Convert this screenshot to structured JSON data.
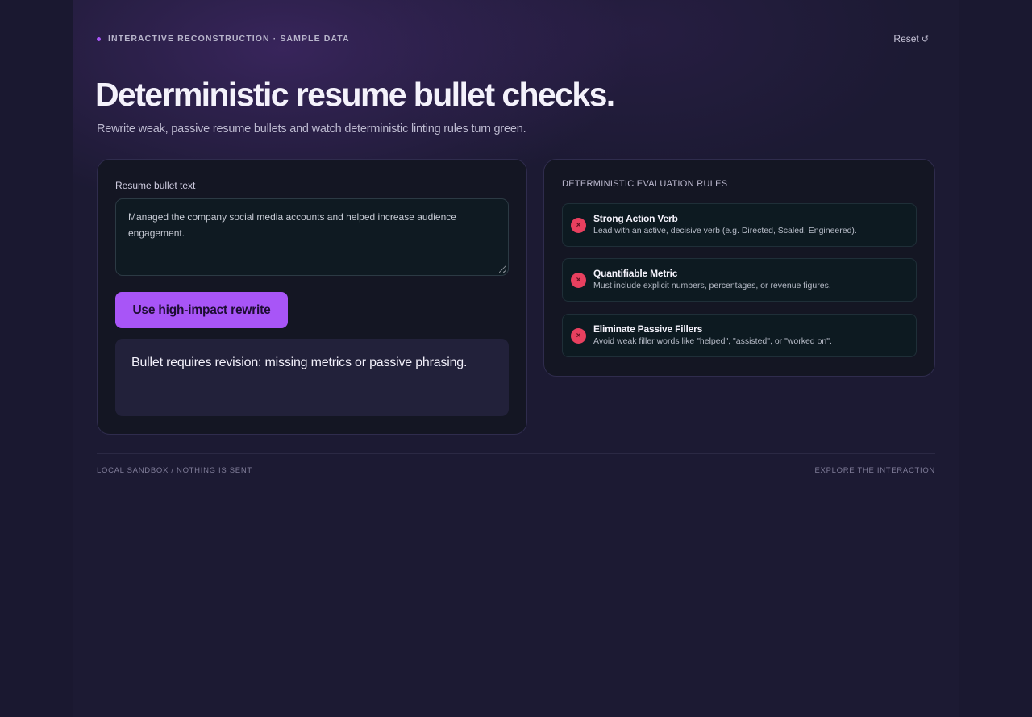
{
  "header": {
    "eyebrow": "INTERACTIVE RECONSTRUCTION · SAMPLE DATA",
    "reset_label": "Reset",
    "reset_icon": "↺"
  },
  "hero": {
    "title": "Deterministic resume bullet checks.",
    "subtitle": "Rewrite weak, passive resume bullets and watch deterministic linting rules turn green."
  },
  "editor": {
    "label": "Resume bullet text",
    "value": "Managed the company social media accounts and helped increase audience engagement.",
    "rewrite_button": "Use high-impact rewrite",
    "status": "Bullet requires revision: missing metrics or passive phrasing."
  },
  "rules": {
    "heading": "DETERMINISTIC EVALUATION RULES",
    "status_icon": "x-circle-icon",
    "fail_color": "#e8405f",
    "items": [
      {
        "title": "Strong Action Verb",
        "description": "Lead with an active, decisive verb (e.g. Directed, Scaled, Engineered).",
        "status": "fail",
        "glyph": "×"
      },
      {
        "title": "Quantifiable Metric",
        "description": "Must include explicit numbers, percentages, or revenue figures.",
        "status": "fail",
        "glyph": "×"
      },
      {
        "title": "Eliminate Passive Fillers",
        "description": "Avoid weak filler words like \"helped\", \"assisted\", or \"worked on\".",
        "status": "fail",
        "glyph": "×"
      }
    ]
  },
  "footer": {
    "left": "LOCAL SANDBOX / NOTHING IS SENT",
    "right": "EXPLORE THE INTERACTION"
  },
  "colors": {
    "accent": "#a855f7",
    "background": "#1a1830"
  }
}
